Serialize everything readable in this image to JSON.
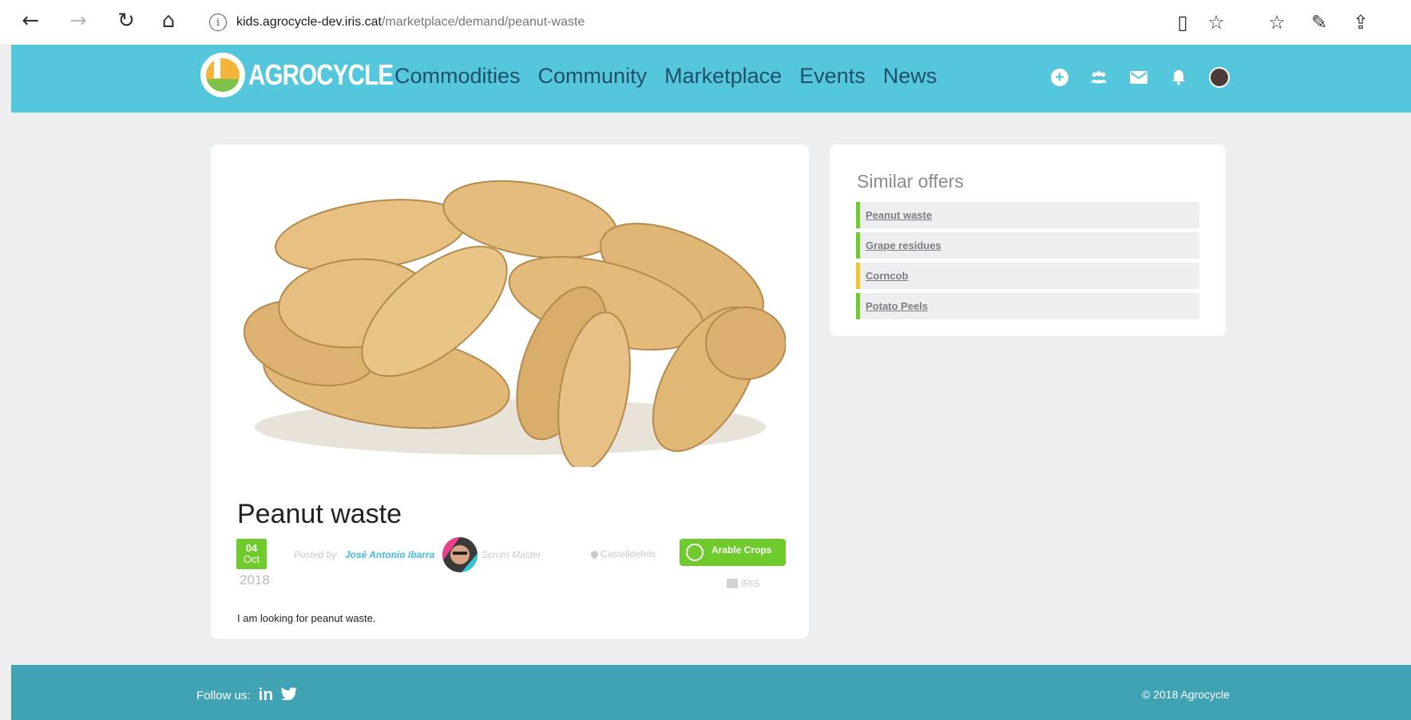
{
  "browser": {
    "url_host": "kids.agrocycle-dev.iris.cat",
    "url_path": "/marketplace/demand/peanut-waste"
  },
  "header": {
    "logo_text": "AGROCYCLE",
    "menu": [
      "Commodities",
      "Community",
      "Marketplace",
      "Events",
      "News"
    ],
    "icons": [
      "add-icon",
      "community-icon",
      "mail-icon",
      "bell-icon",
      "user-avatar-icon"
    ]
  },
  "post": {
    "title": "Peanut waste",
    "date_day": "04",
    "date_month": "Oct",
    "date_year": "2018",
    "posted_by_label": "Posted by",
    "author": "José Antonio Ibarra",
    "role": "Scrum Master",
    "location": "Castelldefels",
    "category": "Arable Crops",
    "organization": "IRIS",
    "description": "I am looking for peanut waste."
  },
  "similar": {
    "title": "Similar offers",
    "items": [
      {
        "label": "Peanut waste",
        "color": "#6fcb2c"
      },
      {
        "label": "Grape residues",
        "color": "#6fcb2c"
      },
      {
        "label": "Corncob",
        "color": "#f2c12e"
      },
      {
        "label": "Potato Peels",
        "color": "#6fcb2c"
      }
    ]
  },
  "footer": {
    "follow_label": "Follow us:",
    "copyright": "© 2018 Agrocycle"
  }
}
